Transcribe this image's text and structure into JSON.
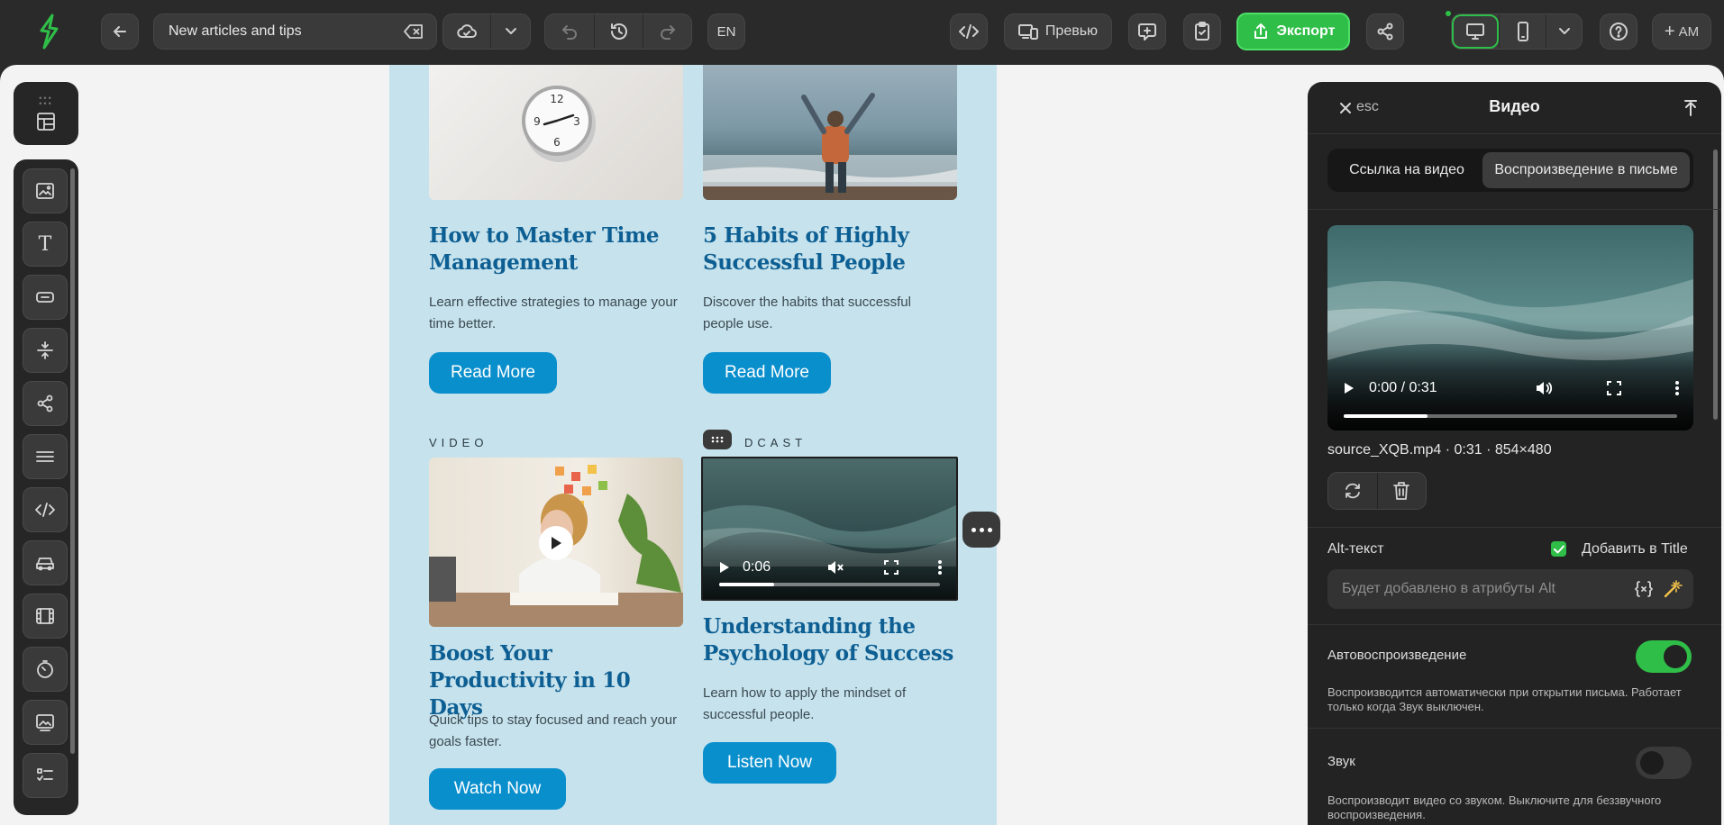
{
  "topbar": {
    "document_title": "New articles and tips",
    "language": "EN",
    "preview_label": "Превью",
    "export_label": "Экспорт",
    "avatar": "AM"
  },
  "email": {
    "cards": [
      {
        "title": "How to Master Time Management",
        "description": "Learn effective strategies to manage your time better.",
        "button": "Read More"
      },
      {
        "title": "5 Habits of Highly Successful People",
        "description": "Discover the habits that successful people use.",
        "button": "Read More"
      },
      {
        "eyebrow": "VIDEO",
        "title": "Boost Your Productivity in 10 Days",
        "description": "Quick tips to stay focused and reach your goals faster.",
        "button": "Watch Now"
      },
      {
        "eyebrow": "PODCAST",
        "eyebrow_visible": "DCAST",
        "title": "Understanding the Psychology of Success",
        "description": "Learn how to apply the mindset of successful people.",
        "button": "Listen Now",
        "video_time": "0:06"
      }
    ]
  },
  "panel": {
    "close_hint": "esc",
    "title": "Видео",
    "tabs": [
      {
        "label": "Ссылка на видео",
        "active": false
      },
      {
        "label": "Воспроизведение в письме",
        "active": true
      }
    ],
    "preview_time": "0:00 / 0:31",
    "file_meta": "source_XQB.mp4 · 0:31 · 854×480",
    "alt_label": "Alt-текст",
    "add_to_title_label": "Добавить в Title",
    "add_to_title_checked": true,
    "alt_placeholder": "Будет добавлено в атрибуты Alt",
    "autoplay_label": "Автовоспроизведение",
    "autoplay_on": true,
    "autoplay_help": "Воспроизводится автоматически при открытии письма. Работает только когда Звук выключен.",
    "sound_label": "Звук",
    "sound_on": false,
    "sound_help": "Воспроизводит видео со звуком. Выключите для беззвучного воспроизведения."
  },
  "colors": {
    "accent_green": "#2fbf48",
    "email_bg": "#c6e2ec",
    "title_blue": "#0d5f93",
    "button_blue": "#0a8fcd"
  }
}
